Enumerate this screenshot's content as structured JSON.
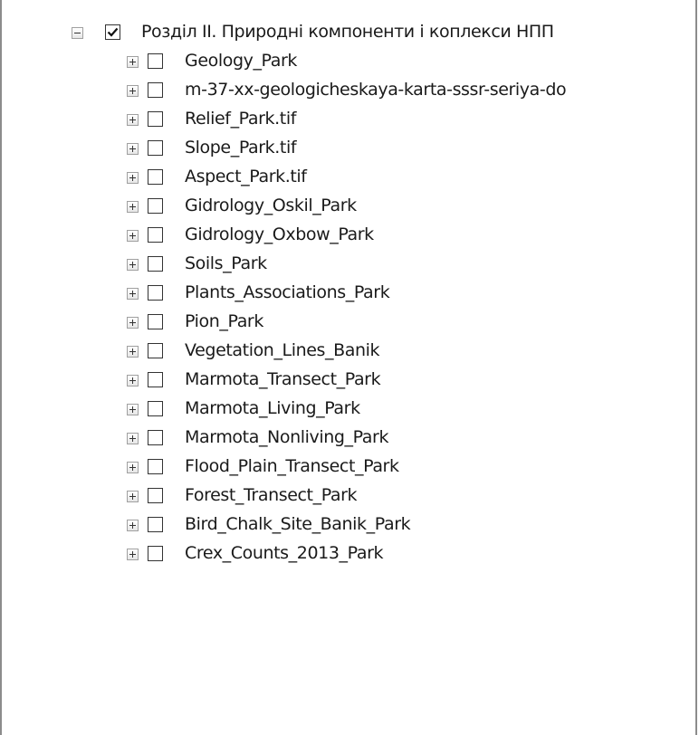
{
  "toc": {
    "group": {
      "label": "Розділ ІІ. Природні компоненти і коплекси НПП",
      "checked": true,
      "expanded": true
    },
    "layers": [
      {
        "label": "Geology_Park",
        "checked": false
      },
      {
        "label": "m-37-xx-geologicheskaya-karta-sssr-seriya-do",
        "checked": false
      },
      {
        "label": "Relief_Park.tif",
        "checked": false
      },
      {
        "label": "Slope_Park.tif",
        "checked": false
      },
      {
        "label": "Aspect_Park.tif",
        "checked": false
      },
      {
        "label": "Gidrology_Oskil_Park",
        "checked": false
      },
      {
        "label": "Gidrology_Oxbow_Park",
        "checked": false
      },
      {
        "label": "Soils_Park",
        "checked": false
      },
      {
        "label": "Plants_Associations_Park",
        "checked": false
      },
      {
        "label": "Pion_Park",
        "checked": false
      },
      {
        "label": "Vegetation_Lines_Banik",
        "checked": false
      },
      {
        "label": "Marmota_Transect_Park",
        "checked": false
      },
      {
        "label": "Marmota_Living_Park",
        "checked": false
      },
      {
        "label": "Marmota_Nonliving_Park",
        "checked": false
      },
      {
        "label": "Flood_Plain_Transect_Park",
        "checked": false
      },
      {
        "label": "Forest_Transect_Park",
        "checked": false
      },
      {
        "label": "Bird_Chalk_Site_Banik_Park",
        "checked": false
      },
      {
        "label": "Crex_Counts_2013_Park",
        "checked": false
      }
    ]
  },
  "icons": {
    "expanded": "minus-box-icon",
    "collapsed": "plus-box-icon",
    "check": "checkmark-icon"
  }
}
